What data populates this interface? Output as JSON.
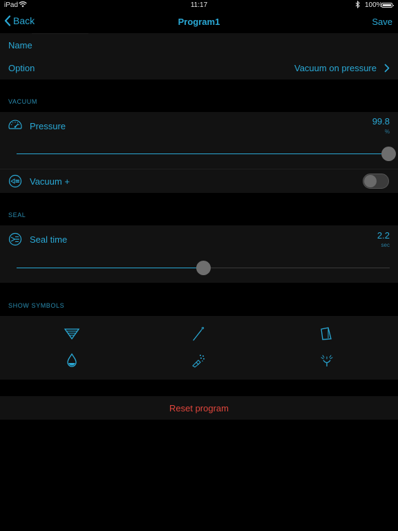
{
  "status_bar": {
    "device": "iPad",
    "time": "11:17",
    "battery": "100%"
  },
  "nav": {
    "back_label": "Back",
    "title": "Program1",
    "save_label": "Save"
  },
  "general": {
    "name_label": "Name",
    "name_value": "",
    "option_label": "Option",
    "option_value": "Vacuum on pressure"
  },
  "vacuum_section": {
    "header": "VACUUM",
    "pressure": {
      "label": "Pressure",
      "value": "99.8",
      "unit": "%",
      "slider_fraction": 0.998,
      "icon": "gauge-icon"
    },
    "vacuum_plus": {
      "label": "Vacuum +",
      "enabled": false,
      "icon": "vacuum-plus-icon"
    }
  },
  "seal_section": {
    "header": "SEAL",
    "seal_time": {
      "label": "Seal time",
      "value": "2.2",
      "unit": "sec",
      "slider_fraction": 0.5,
      "icon": "seal-icon"
    }
  },
  "symbols_section": {
    "header": "SHOW SYMBOLS",
    "symbols": [
      "filter-funnel-icon",
      "needle-icon",
      "container-icon",
      "drop-icon",
      "spray-icon",
      "sprinkle-icon"
    ]
  },
  "reset_label": "Reset program",
  "colors": {
    "accent": "#2aa9d6",
    "background": "#000000",
    "cell": "#121212",
    "destructive": "#e0463c"
  }
}
